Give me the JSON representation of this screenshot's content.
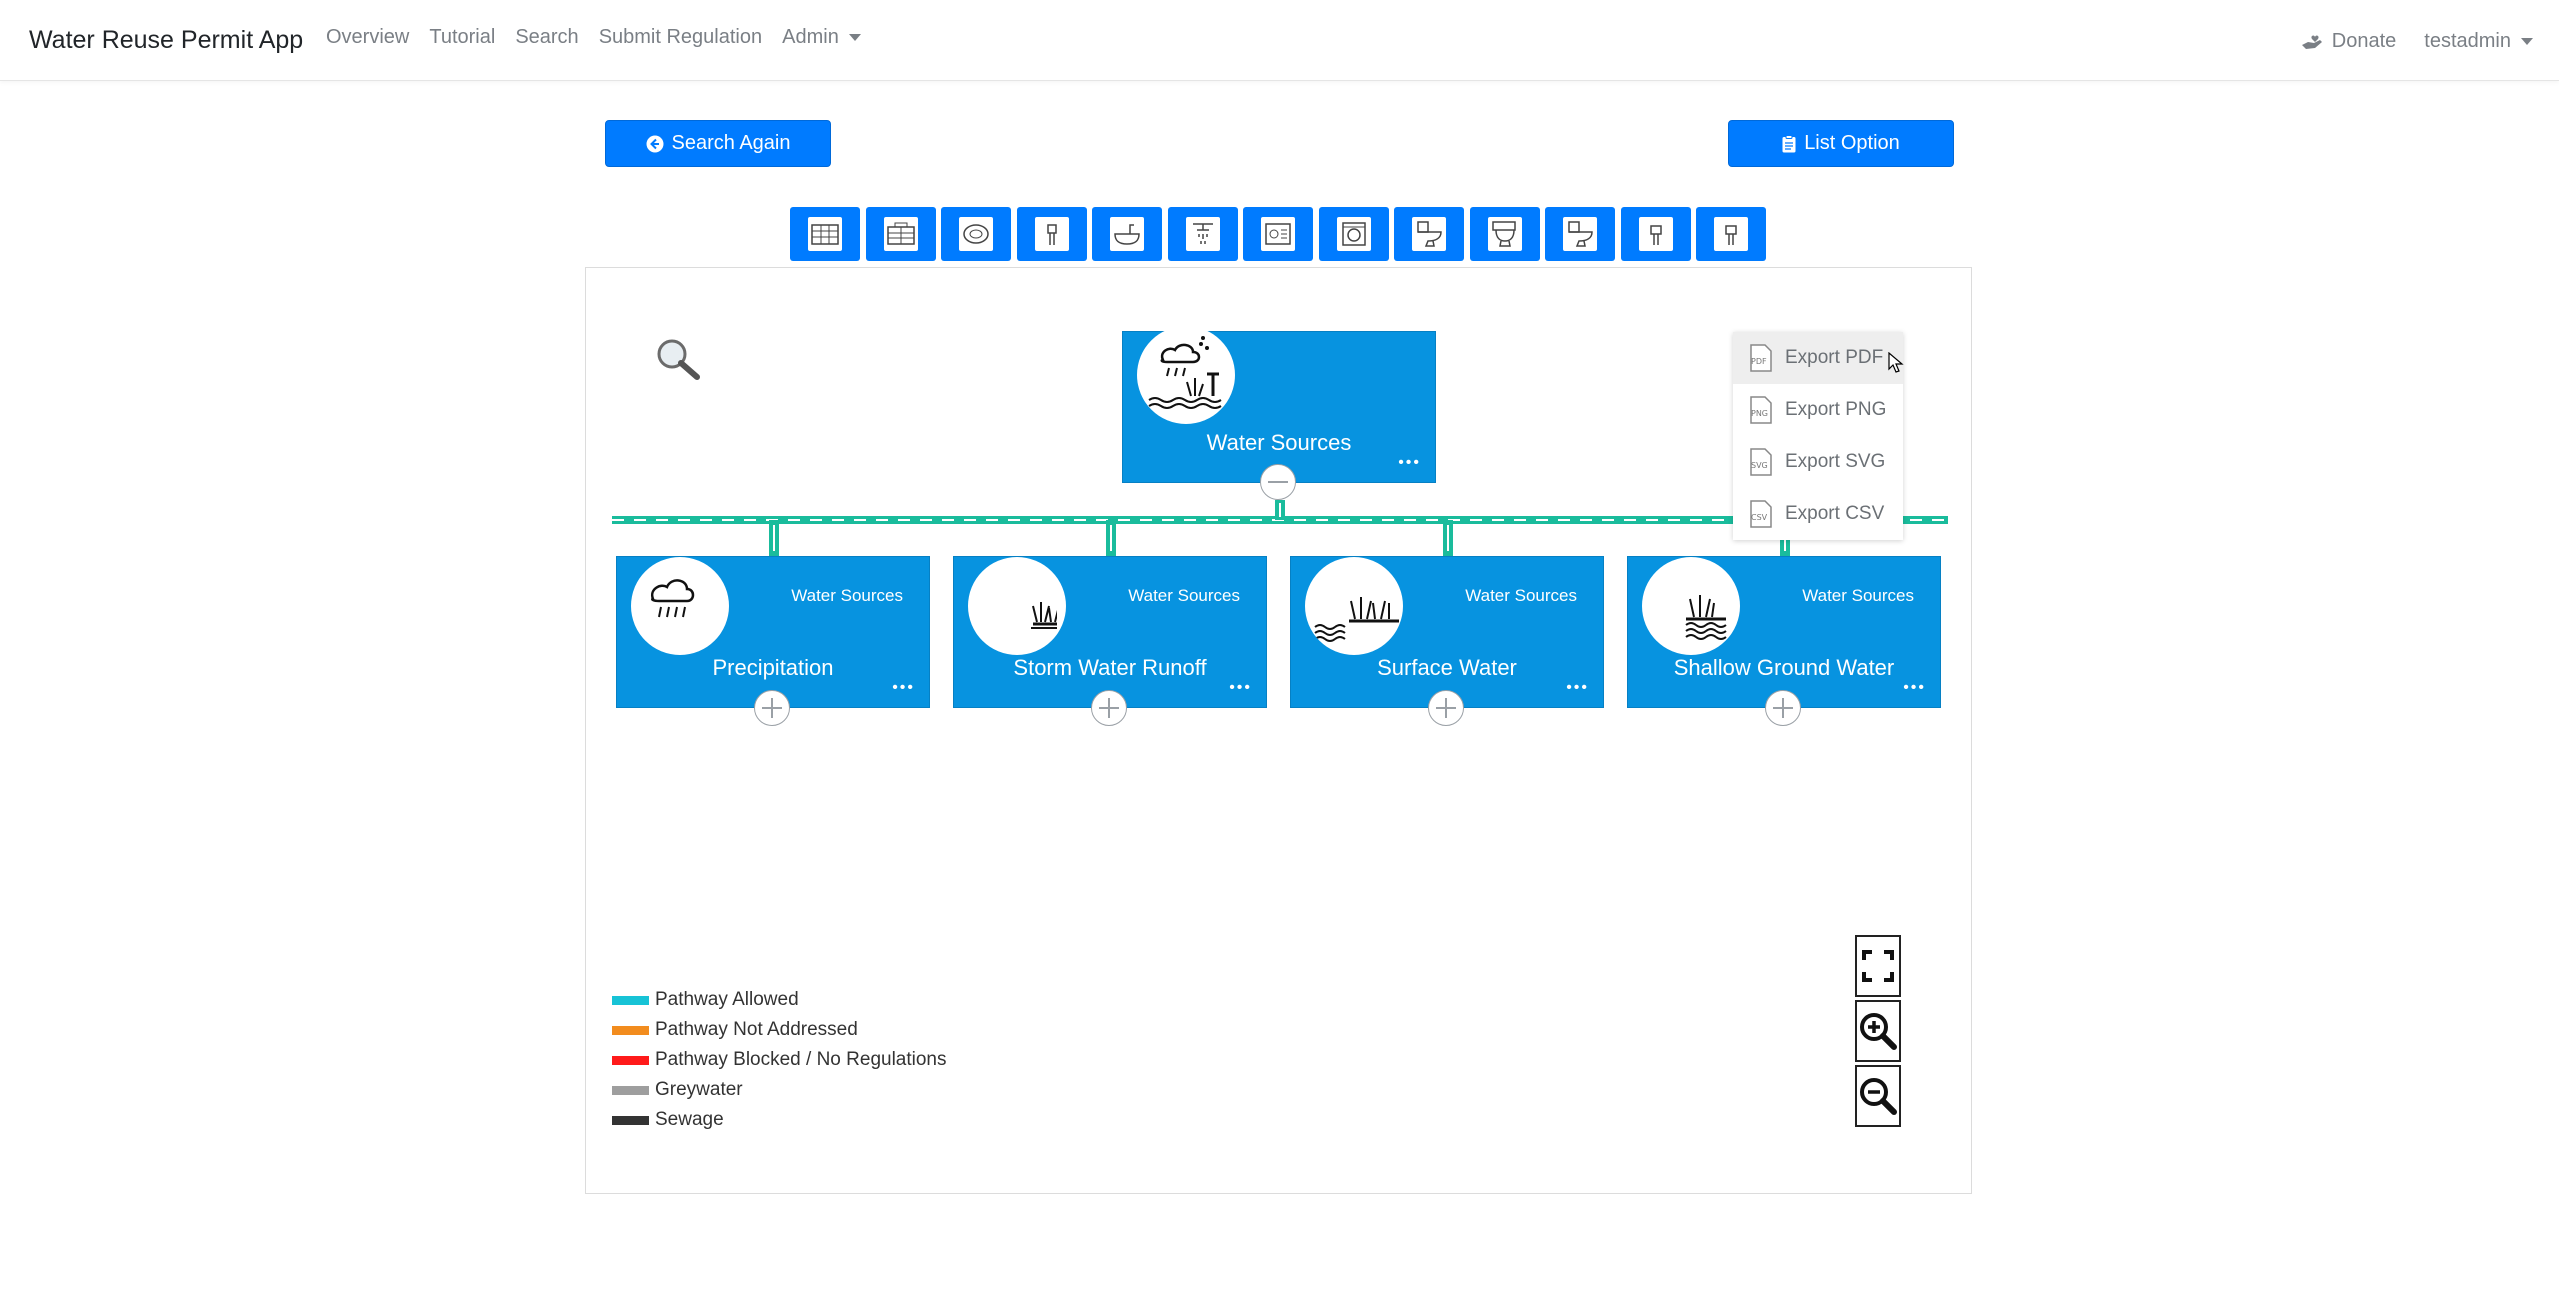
{
  "navbar": {
    "brand": "Water Reuse Permit App",
    "links": [
      "Overview",
      "Tutorial",
      "Search",
      "Submit Regulation",
      "Admin"
    ],
    "donate": "Donate",
    "user": "testadmin"
  },
  "actions": {
    "search_again": "Search Again",
    "list_option": "List Option"
  },
  "fixtures": {
    "count": 13,
    "icons": [
      "building-icon",
      "building-icon",
      "washing-machine-icon",
      "faucet-icon",
      "bathtub-icon",
      "shower-icon",
      "dishwasher-icon",
      "washer-icon",
      "toilet-icon",
      "toilet-icon",
      "toilet-icon",
      "sink-icon",
      "sink-icon"
    ]
  },
  "chart": {
    "root": {
      "name": "Water Sources",
      "icon": "rain-wetland-icon"
    },
    "children": [
      {
        "name": "Precipitation",
        "tag": "Water Sources",
        "icon": "rain-cloud-icon"
      },
      {
        "name": "Storm Water Runoff",
        "tag": "Water Sources",
        "icon": "grass-icon"
      },
      {
        "name": "Surface Water",
        "tag": "Water Sources",
        "icon": "water-grass-icon"
      },
      {
        "name": "Shallow Ground Water",
        "tag": "Water Sources",
        "icon": "ground-water-icon"
      }
    ],
    "more": "•••",
    "link_color": "#1abc9c",
    "node_color": "#0793e0"
  },
  "export_menu": [
    "Export PDF",
    "Export PNG",
    "Export SVG",
    "Export CSV"
  ],
  "export_icons": [
    "PDF",
    "PNG",
    "SVG",
    "CSV"
  ],
  "legend": [
    {
      "label": "Pathway Allowed",
      "color": "#17c3d6"
    },
    {
      "label": "Pathway Not Addressed",
      "color": "#f28c1e"
    },
    {
      "label": "Pathway Blocked / No Regulations",
      "color": "#ff1a1a"
    },
    {
      "label": "Greywater",
      "color": "#9e9e9e"
    },
    {
      "label": "Sewage",
      "color": "#333333"
    }
  ],
  "zoom_controls": [
    "fullscreen-icon",
    "zoom-in-icon",
    "zoom-out-icon"
  ]
}
